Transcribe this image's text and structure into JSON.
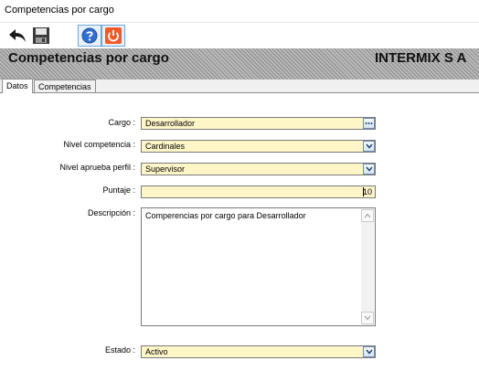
{
  "window": {
    "title": "Competencias por cargo"
  },
  "toolbar": {
    "buttons": [
      {
        "name": "back",
        "icon": "arrow-back-icon"
      },
      {
        "name": "save",
        "icon": "floppy-disk-icon"
      },
      {
        "name": "help",
        "icon": "help-icon"
      },
      {
        "name": "close",
        "icon": "power-icon"
      }
    ]
  },
  "header": {
    "title": "Competencias por cargo",
    "company": "INTERMIX S A"
  },
  "tabs": [
    {
      "label": "Datos",
      "active": true
    },
    {
      "label": "Competencias",
      "active": false
    }
  ],
  "form": {
    "cargo": {
      "label": "Cargo :",
      "value": "Desarrollador"
    },
    "nivel_competencia": {
      "label": "Nivel competencia :",
      "value": "Cardinales"
    },
    "nivel_aprueba": {
      "label": "Nivel aprueba perfil :",
      "value": "Supervisor"
    },
    "puntaje": {
      "label": "Puntaje :",
      "value": "10"
    },
    "descripcion": {
      "label": "Descripción :",
      "value": "Comperencias por cargo para Desarrollador"
    },
    "estado": {
      "label": "Estado :",
      "value": "Activo"
    }
  },
  "colors": {
    "field_bg": "#fff6c8",
    "accent": "#3a78c4",
    "close_orange": "#f05a28"
  }
}
